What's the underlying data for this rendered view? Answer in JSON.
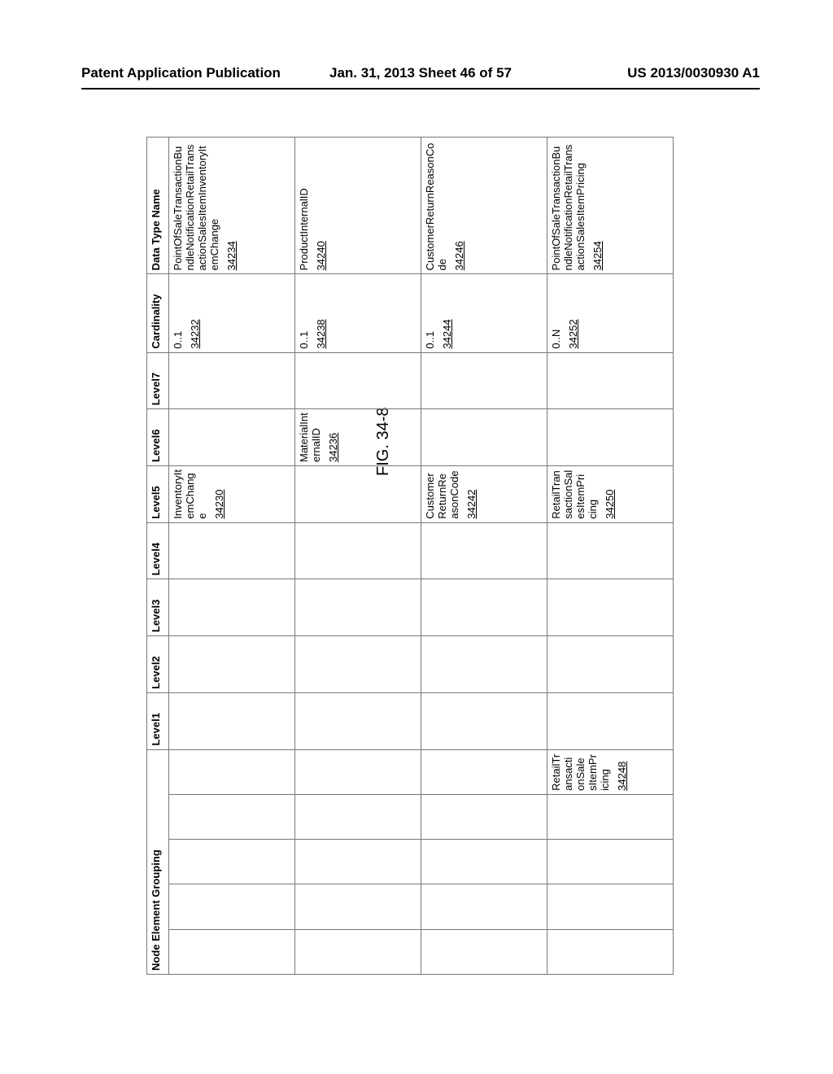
{
  "header": {
    "left": "Patent Application Publication",
    "center": "Jan. 31, 2013  Sheet 46 of 57",
    "right": "US 2013/0030930 A1"
  },
  "figure_label": "FIG. 34-8",
  "columns": {
    "neg_header": "Node Element Grouping",
    "lvl1": "Level1",
    "lvl2": "Level2",
    "lvl3": "Level3",
    "lvl4": "Level4",
    "lvl5": "Level5",
    "lvl6": "Level6",
    "lvl7": "Level7",
    "card": "Cardinality",
    "dtn": "Data Type Name"
  },
  "rows": [
    {
      "neg": [
        "",
        "",
        "",
        "",
        ""
      ],
      "lvl1": "",
      "lvl2": "",
      "lvl3": "",
      "lvl4": "",
      "lvl5": "InventoryItemChange",
      "lvl5_ref": "34230",
      "lvl6": "",
      "lvl6_ref": "",
      "lvl7": "",
      "card": "0..1",
      "card_ref": "34232",
      "dtn": "PointOfSaleTransactionBundleNotificationRetailTransactionSalesItemInventoryItemChange",
      "dtn_ref": "34234"
    },
    {
      "neg": [
        "",
        "",
        "",
        "",
        ""
      ],
      "lvl1": "",
      "lvl2": "",
      "lvl3": "",
      "lvl4": "",
      "lvl5": "",
      "lvl5_ref": "",
      "lvl6": "MaterialInternalID",
      "lvl6_ref": "34236",
      "lvl7": "",
      "card": "0..1",
      "card_ref": "34238",
      "dtn": "ProductInternalID",
      "dtn_ref": "34240"
    },
    {
      "neg": [
        "",
        "",
        "",
        "",
        ""
      ],
      "lvl1": "",
      "lvl2": "",
      "lvl3": "",
      "lvl4": "",
      "lvl5": "CustomerReturnReasonCode",
      "lvl5_ref": "34242",
      "lvl6": "",
      "lvl6_ref": "",
      "lvl7": "",
      "card": "0..1",
      "card_ref": "34244",
      "dtn": "CustomerReturnReasonCode",
      "dtn_ref": "34246"
    },
    {
      "neg": [
        "",
        "",
        "",
        "",
        "RetailTransactionSalesItemPricing"
      ],
      "neg_ref": "34248",
      "lvl1": "",
      "lvl2": "",
      "lvl3": "",
      "lvl4": "",
      "lvl5": "RetailTransactionSalesItemPricing",
      "lvl5_ref": "34250",
      "lvl6": "",
      "lvl6_ref": "",
      "lvl7": "",
      "card": "0..N",
      "card_ref": "34252",
      "dtn": "PointOfSaleTransactionBundleNotificationRetailTransactionSalesItemPricing",
      "dtn_ref": "34254"
    }
  ]
}
